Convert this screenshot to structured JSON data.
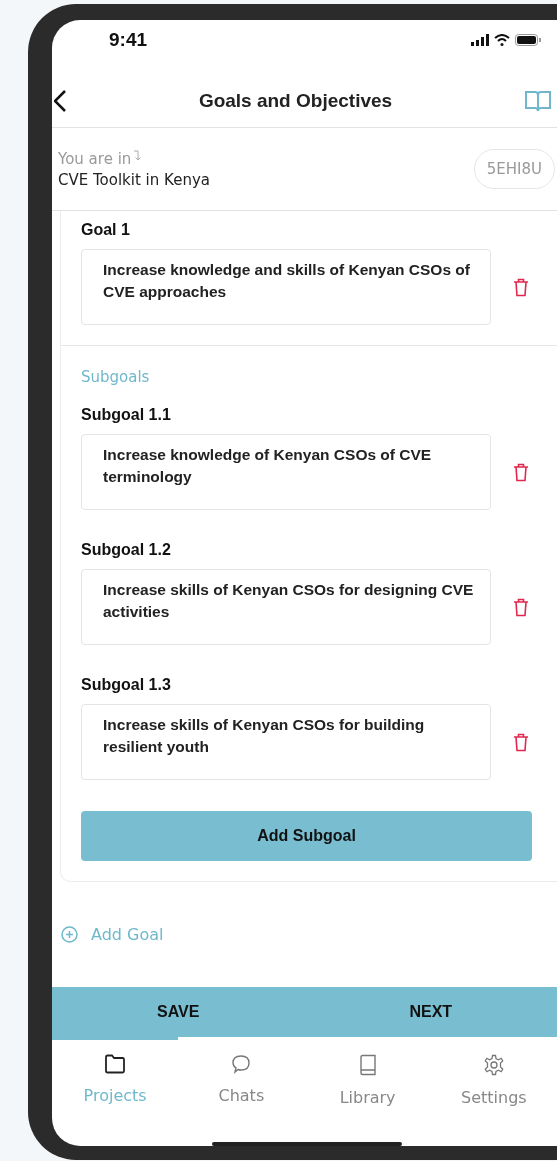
{
  "status_bar": {
    "time": "9:41"
  },
  "header": {
    "title": "Goals and Objectives"
  },
  "context": {
    "label": "You are in",
    "project": "CVE Toolkit in Kenya",
    "code": "5EHI8U"
  },
  "goal": {
    "title": "Goal 1",
    "value": "Increase knowledge and skills of Kenyan CSOs of CVE approaches",
    "subgoals_label": "Subgoals",
    "subgoals": [
      {
        "title": "Subgoal 1.1",
        "value": "Increase knowledge of Kenyan CSOs of CVE terminology"
      },
      {
        "title": "Subgoal 1.2",
        "value": "Increase skills of Kenyan CSOs for designing CVE activities"
      },
      {
        "title": "Subgoal 1.3",
        "value": "Increase skills of Kenyan CSOs for building resilient youth"
      }
    ],
    "add_subgoal": "Add Subgoal"
  },
  "add_goal": "Add Goal",
  "actions": [
    "SAVE",
    "NEXT"
  ],
  "tabs": [
    {
      "label": "Projects",
      "selected": true
    },
    {
      "label": "Chats",
      "selected": false
    },
    {
      "label": "Library",
      "selected": false
    },
    {
      "label": "Settings",
      "selected": false
    }
  ]
}
